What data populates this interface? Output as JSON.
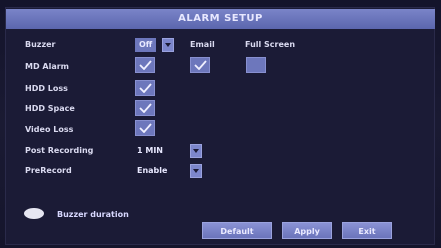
{
  "window": {
    "title": "ALARM SETUP"
  },
  "rows": {
    "buzzer": {
      "label": "Buzzer",
      "value": "Off"
    },
    "email": {
      "label": "Email"
    },
    "full_screen": {
      "label": "Full Screen"
    },
    "md_alarm": {
      "label": "MD Alarm",
      "checked": true
    },
    "md_email": {
      "checked": true
    },
    "md_full_screen": {
      "checked": false
    },
    "hdd_loss": {
      "label": "HDD Loss",
      "checked": true
    },
    "hdd_space": {
      "label": "HDD Space",
      "checked": true
    },
    "video_loss": {
      "label": "Video Loss",
      "checked": true
    },
    "post_recording": {
      "label": "Post Recording",
      "value": "1 MIN"
    },
    "prerecord": {
      "label": "PreRecord",
      "value": "Enable"
    }
  },
  "footer": {
    "hint": "Buzzer duration",
    "default_label": "Default",
    "apply_label": "Apply",
    "exit_label": "Exit"
  }
}
